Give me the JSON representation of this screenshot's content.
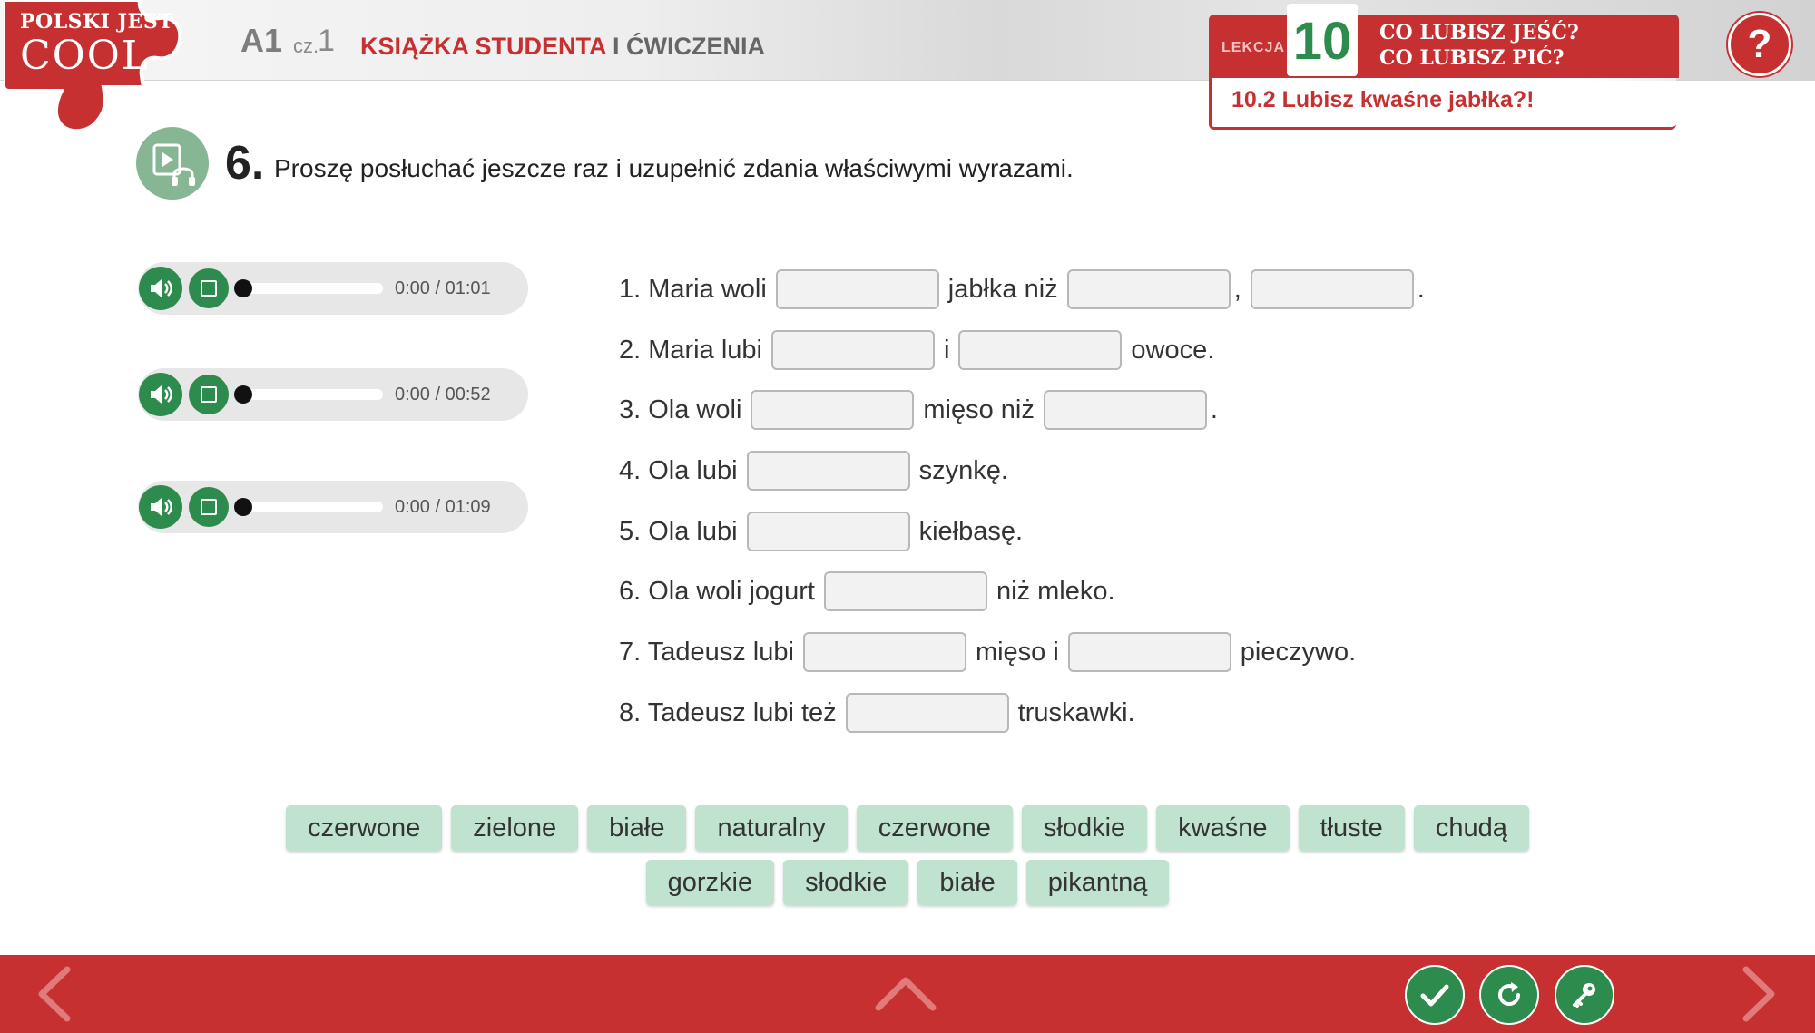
{
  "logo": {
    "top": "POLSKI JEST",
    "main": "COOL"
  },
  "header": {
    "level": "A1",
    "part_label": "cz.",
    "part_num": "1",
    "book_title_red": "KSIĄŻKA STUDENTA",
    "book_title_gray": "I ĆWICZENIA"
  },
  "lesson": {
    "label": "LEKCJA",
    "number": "10",
    "title_line1": "CO LUBISZ JEŚĆ?",
    "title_line2": "CO LUBISZ PIĆ?",
    "subtitle": "10.2 Lubisz kwaśne jabłka?!"
  },
  "help": {
    "label": "?"
  },
  "task": {
    "number": "6.",
    "instruction": "Proszę posłuchać jeszcze raz i uzupełnić zdania właściwymi wyrazami.",
    "icon": "video-headphones-icon"
  },
  "players": [
    {
      "time": "0:00 / 01:01",
      "progress": 0
    },
    {
      "time": "0:00 / 00:52",
      "progress": 0
    },
    {
      "time": "0:00 / 01:09",
      "progress": 0
    }
  ],
  "sentences": [
    {
      "p1": "1. Maria woli",
      "p2": "jabłka niż",
      "p3": ",",
      "p4": "."
    },
    {
      "p1": "2. Maria lubi",
      "p2": "i",
      "p3": "owoce."
    },
    {
      "p1": "3. Ola woli",
      "p2": "mięso niż",
      "p3": "."
    },
    {
      "p1": "4. Ola lubi",
      "p2": "szynkę."
    },
    {
      "p1": "5. Ola lubi",
      "p2": "kiełbasę."
    },
    {
      "p1": "6. Ola woli jogurt",
      "p2": "niż mleko."
    },
    {
      "p1": "7. Tadeusz lubi",
      "p2": "mięso i",
      "p3": "pieczywo."
    },
    {
      "p1": "8. Tadeusz lubi też",
      "p2": "truskawki."
    }
  ],
  "word_bank": {
    "row1": [
      "czerwone",
      "zielone",
      "białe",
      "naturalny",
      "czerwone",
      "słodkie",
      "kwaśne",
      "tłuste",
      "chudą"
    ],
    "row2": [
      "gorzkie",
      "słodkie",
      "białe",
      "pikantną"
    ]
  },
  "colors": {
    "brand_red": "#c63031",
    "accent_green": "#2e8b4e",
    "chip_green": "#bfe3cf"
  }
}
